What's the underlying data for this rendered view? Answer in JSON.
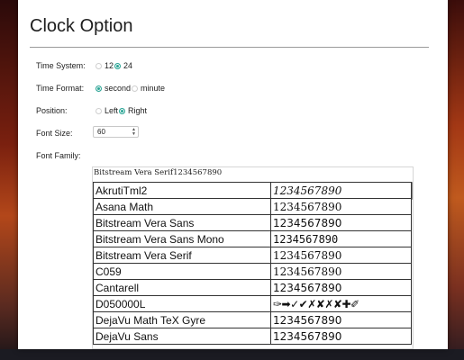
{
  "title": "Clock Option",
  "time_system": {
    "label": "Time System:",
    "options": [
      {
        "label": "12",
        "selected": false
      },
      {
        "label": "24",
        "selected": true
      }
    ]
  },
  "time_format": {
    "label": "Time Format:",
    "options": [
      {
        "label": "second",
        "selected": true
      },
      {
        "label": "minute",
        "selected": false
      }
    ]
  },
  "position": {
    "label": "Position:",
    "options": [
      {
        "label": "Left",
        "selected": false
      },
      {
        "label": "Right",
        "selected": true
      }
    ]
  },
  "font_size": {
    "label": "Font Size:",
    "value": "60"
  },
  "font_family": {
    "label": "Font Family:",
    "selected_preview": "Bitstream Vera Serif1234567890",
    "rows": [
      {
        "name": "AkrutiTml2",
        "sample": "1234567890"
      },
      {
        "name": "Asana Math",
        "sample": "1234567890"
      },
      {
        "name": "Bitstream Vera Sans",
        "sample": "1234567890"
      },
      {
        "name": "Bitstream Vera Sans Mono",
        "sample": "1234567890"
      },
      {
        "name": "Bitstream Vera Serif",
        "sample": "1234567890"
      },
      {
        "name": "C059",
        "sample": "1234567890"
      },
      {
        "name": "Cantarell",
        "sample": "1234567890"
      },
      {
        "name": "D050000L",
        "sample": "✑➡✓✔✗✘✗✘✚✐"
      },
      {
        "name": "DejaVu Math TeX Gyre",
        "sample": "1234567890"
      },
      {
        "name": "DejaVu Sans",
        "sample": "1234567890"
      }
    ]
  },
  "colors": {
    "accent": "#2ba595",
    "divider": "#9a9a9a"
  }
}
